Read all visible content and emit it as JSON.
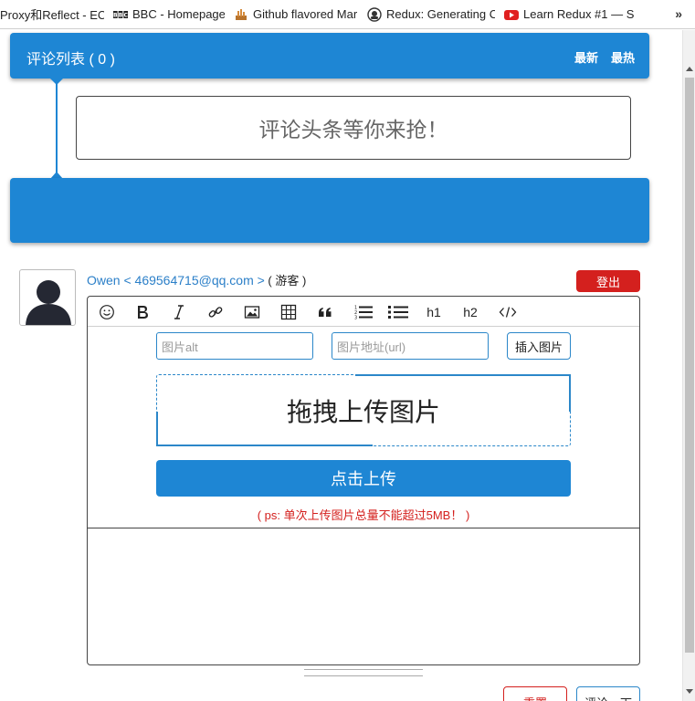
{
  "bookmarks": [
    {
      "label": "Proxy和Reflect - ECM",
      "icon": "none"
    },
    {
      "label": "BBC - Homepage",
      "icon": "bbc-icon"
    },
    {
      "label": "Github flavored Mar",
      "icon": "github-flavored-icon"
    },
    {
      "label": "Redux: Generating C",
      "icon": "redux-icon"
    },
    {
      "label": "Learn Redux #1 — S",
      "icon": "youtube-icon"
    }
  ],
  "bookmarks_more": "»",
  "comment_list": {
    "title": "评论列表 ( 0 )",
    "sort_latest": "最新",
    "sort_hot": "最热",
    "empty_message": "评论头条等你来抢！"
  },
  "user": {
    "name_email": "Owen < 469564715@qq.com >",
    "role": " ( 游客 )",
    "logout": "登出"
  },
  "toolbar": {
    "h1": "h1",
    "h2": "h2"
  },
  "image_panel": {
    "alt_placeholder": "图片alt",
    "url_placeholder": "图片地址(url)",
    "insert_button": "插入图片",
    "dropzone_text": "拖拽上传图片",
    "upload_button": "点击上传",
    "note": "( ps: 单次上传图片总量不能超过5MB！ )"
  },
  "actions": {
    "reset": "重置",
    "submit": "评论一下"
  },
  "colors": {
    "primary": "#1e86d4",
    "danger": "#d4201e",
    "link": "#2b7fc8"
  }
}
